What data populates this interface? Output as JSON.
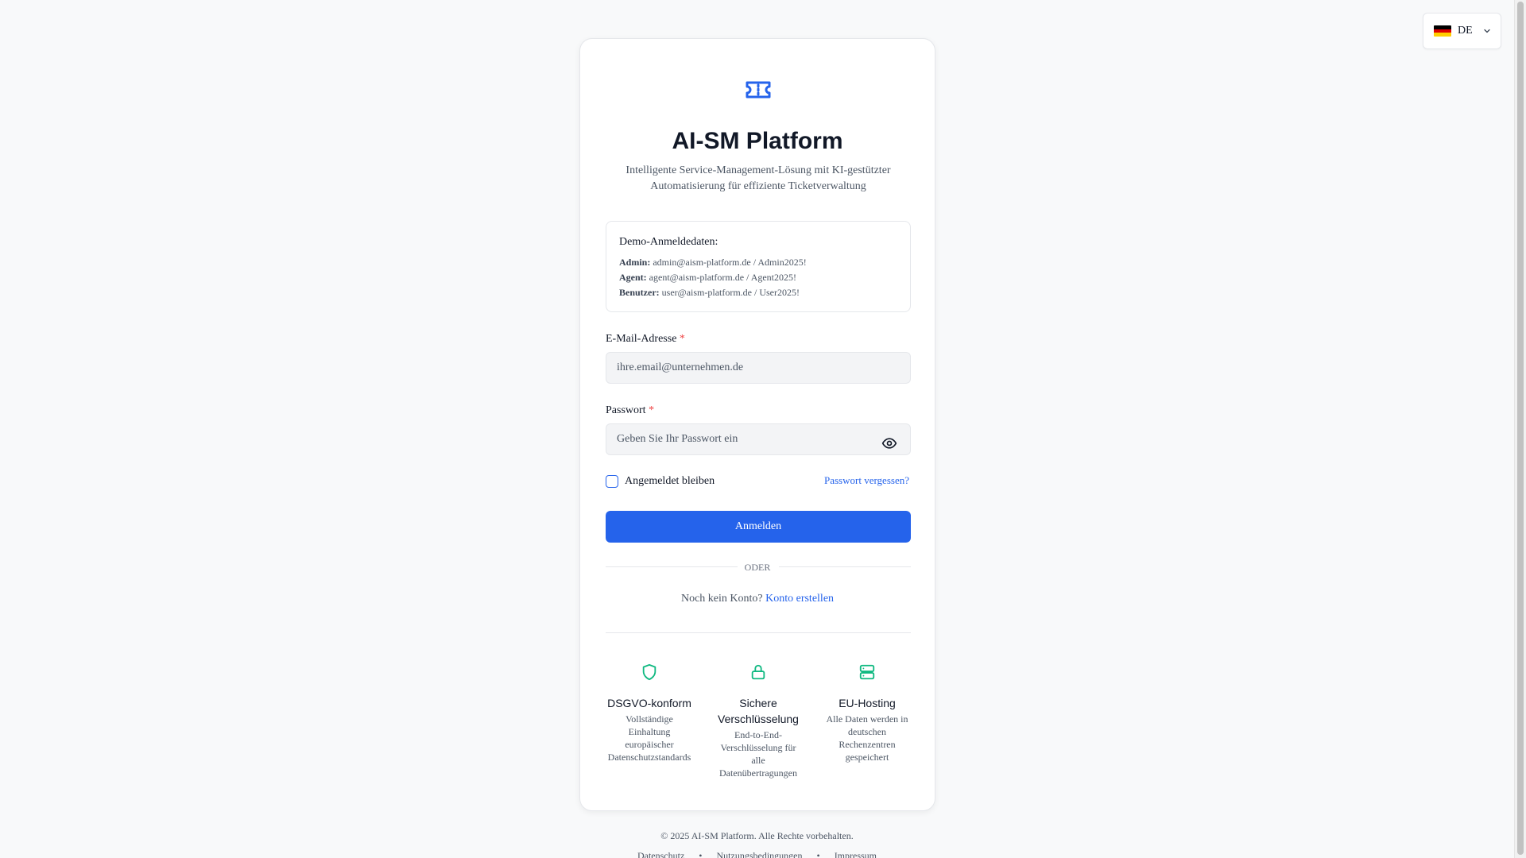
{
  "language": {
    "code": "DE",
    "flag": "german-flag-icon"
  },
  "brand": {
    "logo": "ticket-icon",
    "title": "AI-SM Platform",
    "subtitle": "Intelligente Service-Management-Lösung mit KI-gestützter Automatisierung für effiziente Ticketverwaltung"
  },
  "demo": {
    "title": "Demo-Anmeldedaten:",
    "accounts": [
      {
        "role": "Admin:",
        "credentials": "admin@aism-platform.de / Admin2025!"
      },
      {
        "role": "Agent:",
        "credentials": "agent@aism-platform.de / Agent2025!"
      },
      {
        "role": "Benutzer:",
        "credentials": "user@aism-platform.de / User2025!"
      }
    ]
  },
  "form": {
    "email_label": "E-Mail-Adresse",
    "email_placeholder": "ihre.email@unternehmen.de",
    "email_value": "",
    "password_label": "Passwort",
    "password_placeholder": "Geben Sie Ihr Passwort ein",
    "password_value": "",
    "required_marker": "*",
    "remember_label": "Angemeldet bleiben",
    "remember_checked": false,
    "forgot_label": "Passwort vergessen?",
    "submit_label": "Anmelden",
    "or_label": "ODER",
    "signup_prompt": "Noch kein Konto?",
    "signup_link": "Konto erstellen"
  },
  "features": [
    {
      "icon": "shield-icon",
      "title": "DSGVO-konform",
      "desc": "Vollständige Einhaltung europäischer Datenschutzstandards"
    },
    {
      "icon": "lock-icon",
      "title": "Sichere Verschlüsselung",
      "desc": "End-to-End-Verschlüsselung für alle Datenübertragungen"
    },
    {
      "icon": "server-icon",
      "title": "EU-Hosting",
      "desc": "Alle Daten werden in deutschen Rechenzentren gespeichert"
    }
  ],
  "footer": {
    "copyright": "© 2025 AI-SM Platform. Alle Rechte vorbehalten.",
    "links": [
      "Datenschutz",
      "Nutzungsbedingungen",
      "Impressum"
    ],
    "separator": "•"
  },
  "colors": {
    "primary": "#2563eb",
    "feature_icon": "#10b981",
    "required": "#ef4444",
    "background": "#f8f9fa"
  }
}
